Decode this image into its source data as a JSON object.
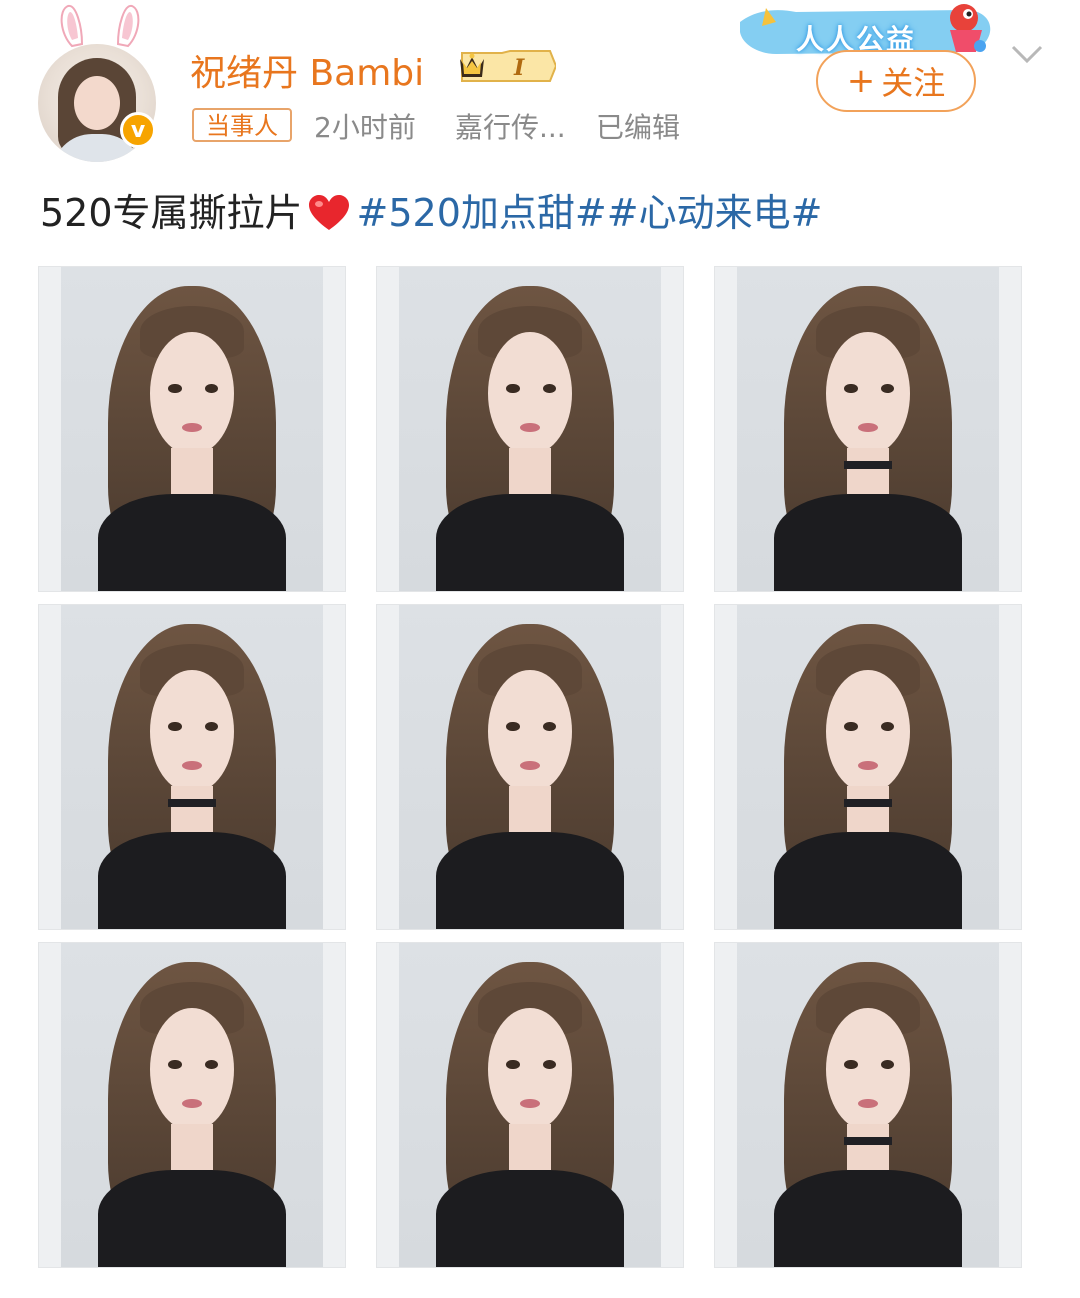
{
  "post": {
    "author": {
      "name": "祝绪丹 Bambi",
      "level_badge": "I",
      "verified": true,
      "verify_mark": "v"
    },
    "role_tag": "当事人",
    "time": "2小时前",
    "source": "嘉行传...",
    "edited": "已编辑",
    "promo_label": "人人公益",
    "follow_label": "关注",
    "follow_plus": "+",
    "text_plain": "520专属撕拉片",
    "emoji": "heart-emoji",
    "hashtags": [
      "#520加点甜#",
      "#心动来电#"
    ]
  },
  "gallery": {
    "count": 9,
    "photos": [
      {
        "label": "photo-1"
      },
      {
        "label": "photo-2"
      },
      {
        "label": "photo-3"
      },
      {
        "label": "photo-4"
      },
      {
        "label": "photo-5"
      },
      {
        "label": "photo-6"
      },
      {
        "label": "photo-7"
      },
      {
        "label": "photo-8"
      },
      {
        "label": "photo-9"
      }
    ]
  },
  "colors": {
    "accent_orange": "#e8761e",
    "hashtag_blue": "#2b68a6",
    "meta_gray": "#8a8a8a",
    "verify_gold": "#f7a400"
  }
}
